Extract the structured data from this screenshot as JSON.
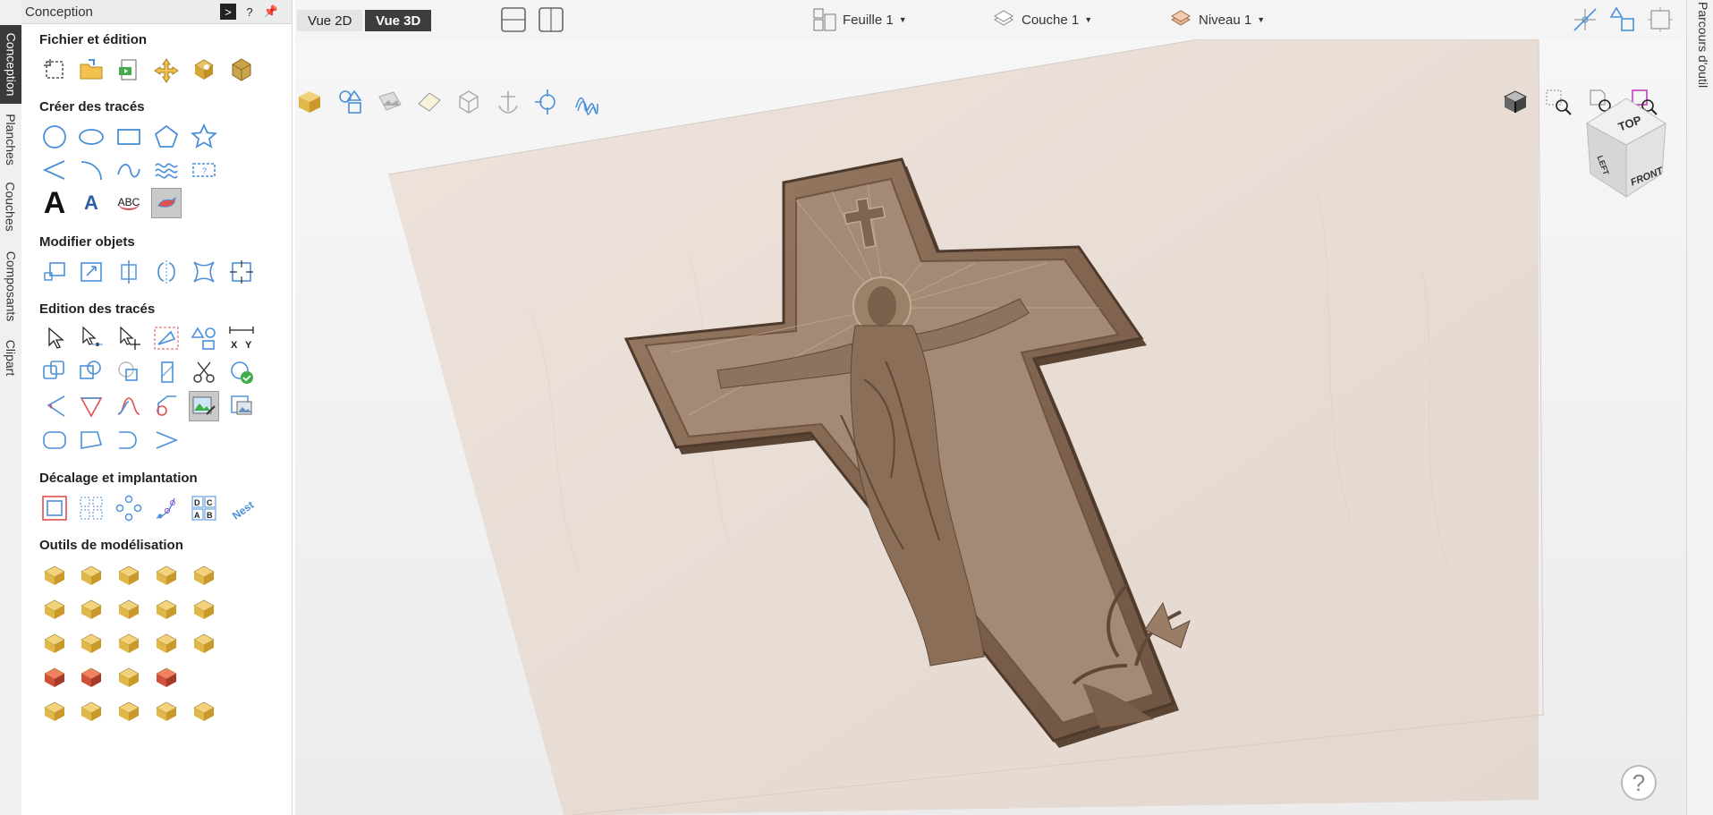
{
  "panel": {
    "title": "Conception",
    "help_label": "?",
    "sections": [
      {
        "title": "Fichier et édition"
      },
      {
        "title": "Créer des tracés"
      },
      {
        "title": "Modifier objets"
      },
      {
        "title": "Edition des tracés"
      },
      {
        "title": "Décalage et implantation"
      },
      {
        "title": "Outils de modélisation"
      }
    ]
  },
  "left_tabs": [
    "Conception",
    "Planches",
    "Couches",
    "Composants",
    "Clipart"
  ],
  "right_tab": "Parcours d'outil",
  "topbar": {
    "view2d": "Vue 2D",
    "view3d": "Vue 3D",
    "sheet": "Feuille 1",
    "layer": "Couche 1",
    "level": "Niveau 1"
  },
  "tool_glyphs": {
    "text_large": "A",
    "text_small": "A",
    "text_arc": "ABC",
    "dim_x": "X",
    "dim_y": "Y",
    "label_d": "D",
    "label_c": "C",
    "label_a": "A",
    "label_b": "B",
    "nest": "Nest"
  },
  "viewcube": {
    "top": "TOP",
    "left": "LEFT",
    "front": "FRONT"
  },
  "help": "?",
  "colors": {
    "accent": "#4a8fd8",
    "wood": "#e9ded6",
    "relief": "#8a6e58",
    "active_tab": "#3a3a3a"
  }
}
